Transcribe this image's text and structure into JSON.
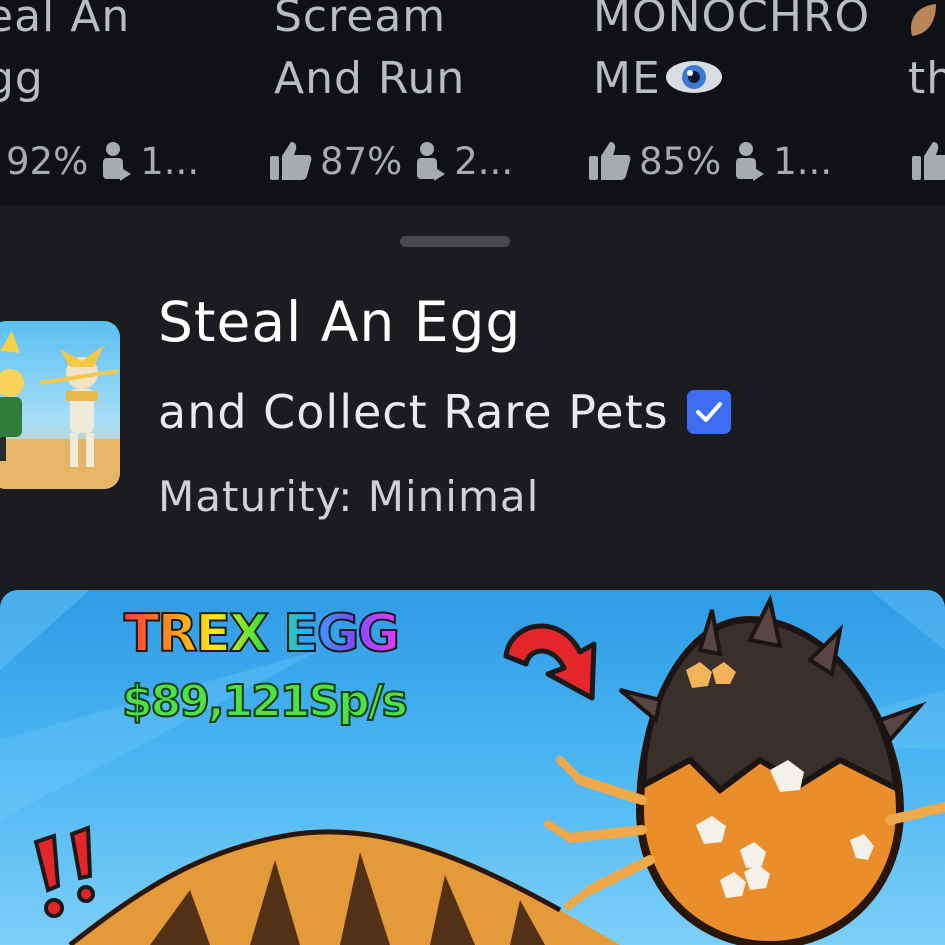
{
  "carousel": {
    "cards": [
      {
        "title": "eal An\ngg",
        "rating": "92%",
        "players": "1..."
      },
      {
        "title": "Scream\nAnd Run",
        "rating": "87%",
        "players": "2..."
      },
      {
        "title": "MONOCHRO\nME",
        "rating": "85%",
        "players": "1..."
      },
      {
        "title": "\nth",
        "rating": "",
        "players": ""
      }
    ]
  },
  "game": {
    "title": "Steal An Egg",
    "subtitle": "and Collect Rare Pets",
    "maturity": "Maturity: Minimal"
  },
  "thumbnail": {
    "headline": "TREX EGG",
    "rate": "$89,121Sp/s",
    "alert": "!!"
  },
  "colors": {
    "carousel_bg": "#101114",
    "sheet_bg": "#1b1c20",
    "verified_badge": "#3d6df2",
    "thumbnail_sky": "#48b4f2"
  },
  "icons": [
    "thumbs-up-icon",
    "player-icon",
    "eye-icon",
    "verified-badge-icon",
    "curved-arrow-icon"
  ]
}
